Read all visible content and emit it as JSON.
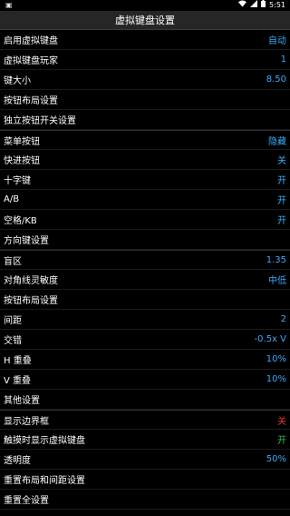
{
  "statusbar": {
    "time": "5:51",
    "left_icon": "image-icon"
  },
  "title": "虚拟键盘设置",
  "rows": [
    {
      "label": "启用虚拟键盘",
      "value": "自动",
      "color": "#3fa9f5"
    },
    {
      "label": "虚拟键盘玩家",
      "value": "1",
      "color": "#3fa9f5"
    },
    {
      "label": "键大小",
      "value": "8.50",
      "color": "#3fa9f5"
    },
    {
      "label": "按钮布局设置",
      "value": "",
      "color": "#3fa9f5"
    },
    {
      "label": "独立按钮开关设置",
      "value": "",
      "color": "#3fa9f5"
    },
    {
      "label": "菜单按钮",
      "value": "隐藏",
      "color": "#3fa9f5"
    },
    {
      "label": "快进按钮",
      "value": "关",
      "color": "#3fa9f5"
    },
    {
      "label": "十字键",
      "value": "开",
      "color": "#3fa9f5"
    },
    {
      "label": "A/B",
      "value": "开",
      "color": "#3fa9f5"
    },
    {
      "label": "空格/KB",
      "value": "开",
      "color": "#3fa9f5"
    },
    {
      "label": "方向键设置",
      "value": "",
      "color": "#3fa9f5"
    },
    {
      "label": "盲区",
      "value": "1.35",
      "color": "#3fa9f5"
    },
    {
      "label": "对角线灵敏度",
      "value": "中低",
      "color": "#3fa9f5"
    },
    {
      "label": "按钮布局设置",
      "value": "",
      "color": "#3fa9f5"
    },
    {
      "label": "间距",
      "value": "2",
      "color": "#3fa9f5"
    },
    {
      "label": "交错",
      "value": "-0.5x V",
      "color": "#3fa9f5"
    },
    {
      "label": "H 重叠",
      "value": "10%",
      "color": "#3fa9f5"
    },
    {
      "label": "V 重叠",
      "value": "10%",
      "color": "#3fa9f5"
    },
    {
      "label": "其他设置",
      "value": "",
      "color": "#3fa9f5"
    },
    {
      "label": "显示边界框",
      "value": "关",
      "color": "#e0392b"
    },
    {
      "label": "触摸时显示虚拟键盘",
      "value": "开",
      "color": "#39b54a"
    },
    {
      "label": "透明度",
      "value": "50%",
      "color": "#3fa9f5"
    },
    {
      "label": "重置布局和间距设置",
      "value": "",
      "color": "#3fa9f5"
    },
    {
      "label": "重置全设置",
      "value": "",
      "color": "#3fa9f5"
    }
  ]
}
